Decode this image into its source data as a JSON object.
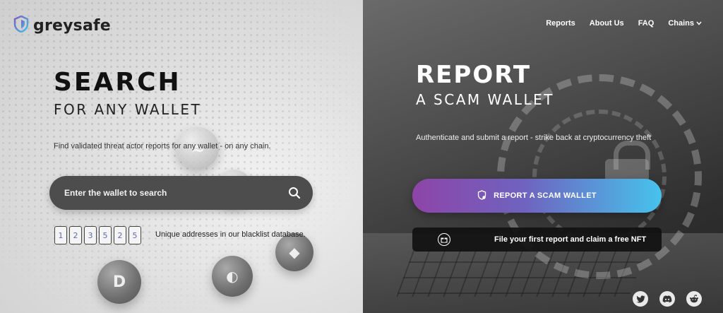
{
  "brand": {
    "name": "greysafe"
  },
  "nav": {
    "items": [
      {
        "label": "Reports"
      },
      {
        "label": "About Us"
      },
      {
        "label": "FAQ"
      },
      {
        "label": "Chains"
      }
    ]
  },
  "search": {
    "title": "SEARCH",
    "subtitle": "FOR ANY WALLET",
    "description": "Find validated threat actor reports for any wallet - on any chain.",
    "placeholder": "Enter the wallet to search",
    "counter_digits": [
      "1",
      "2",
      "3",
      "5",
      "2",
      "5"
    ],
    "counter_label": "Unique addresses in our blacklist database."
  },
  "report": {
    "title": "REPORT",
    "subtitle": "A SCAM WALLET",
    "description": "Authenticate and submit a report - strike back at cryptocurrency theft",
    "button_label": "REPORT A SCAM WALLET",
    "nft_label": "File your first report and claim a free NFT"
  },
  "social": {
    "items": [
      {
        "icon": "twitter-icon"
      },
      {
        "icon": "discord-icon"
      },
      {
        "icon": "reddit-icon"
      }
    ]
  },
  "colors": {
    "button_gradient_start": "#8e44a8",
    "button_gradient_end": "#46c3ec",
    "search_bar": "#4d4d4d",
    "digit_text": "#5a6bb5"
  }
}
